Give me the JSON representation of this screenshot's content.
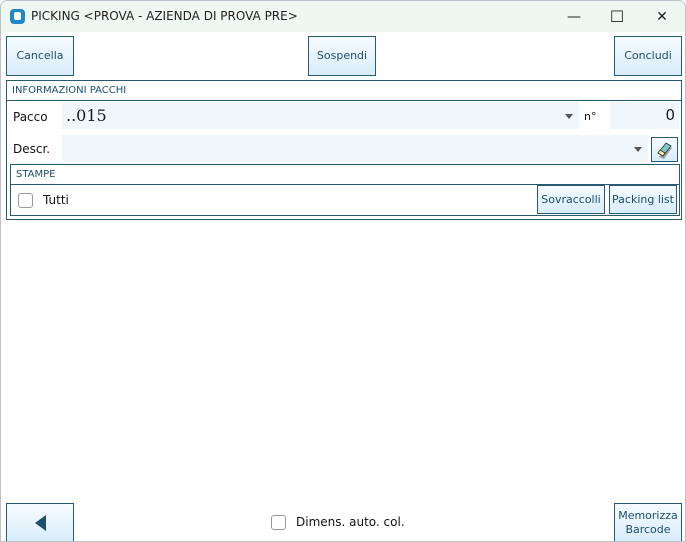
{
  "window": {
    "title": "PICKING <PROVA - AZIENDA DI PROVA PRE>",
    "minimize": "—",
    "maximize": "☐",
    "close": "✕"
  },
  "toolbar": {
    "cancel": "Cancella",
    "suspend": "Sospendi",
    "conclude": "Concludi"
  },
  "info_panel": {
    "title": "INFORMAZIONI PACCHI",
    "pacco_label": "Pacco",
    "pacco_value": "..015",
    "number_label": "n°",
    "number_value": "0",
    "descr_label": "Descr.",
    "descr_value": ""
  },
  "print_panel": {
    "title": "STAMPE",
    "all_label": "Tutti",
    "all_checked": false,
    "overpack": "Sovraccolli",
    "packing_list": "Packing list"
  },
  "footer": {
    "auto_size_label": "Dimens. auto. col.",
    "auto_size_checked": false,
    "save_barcode_line1": "Memorizza",
    "save_barcode_line2": "Barcode"
  }
}
